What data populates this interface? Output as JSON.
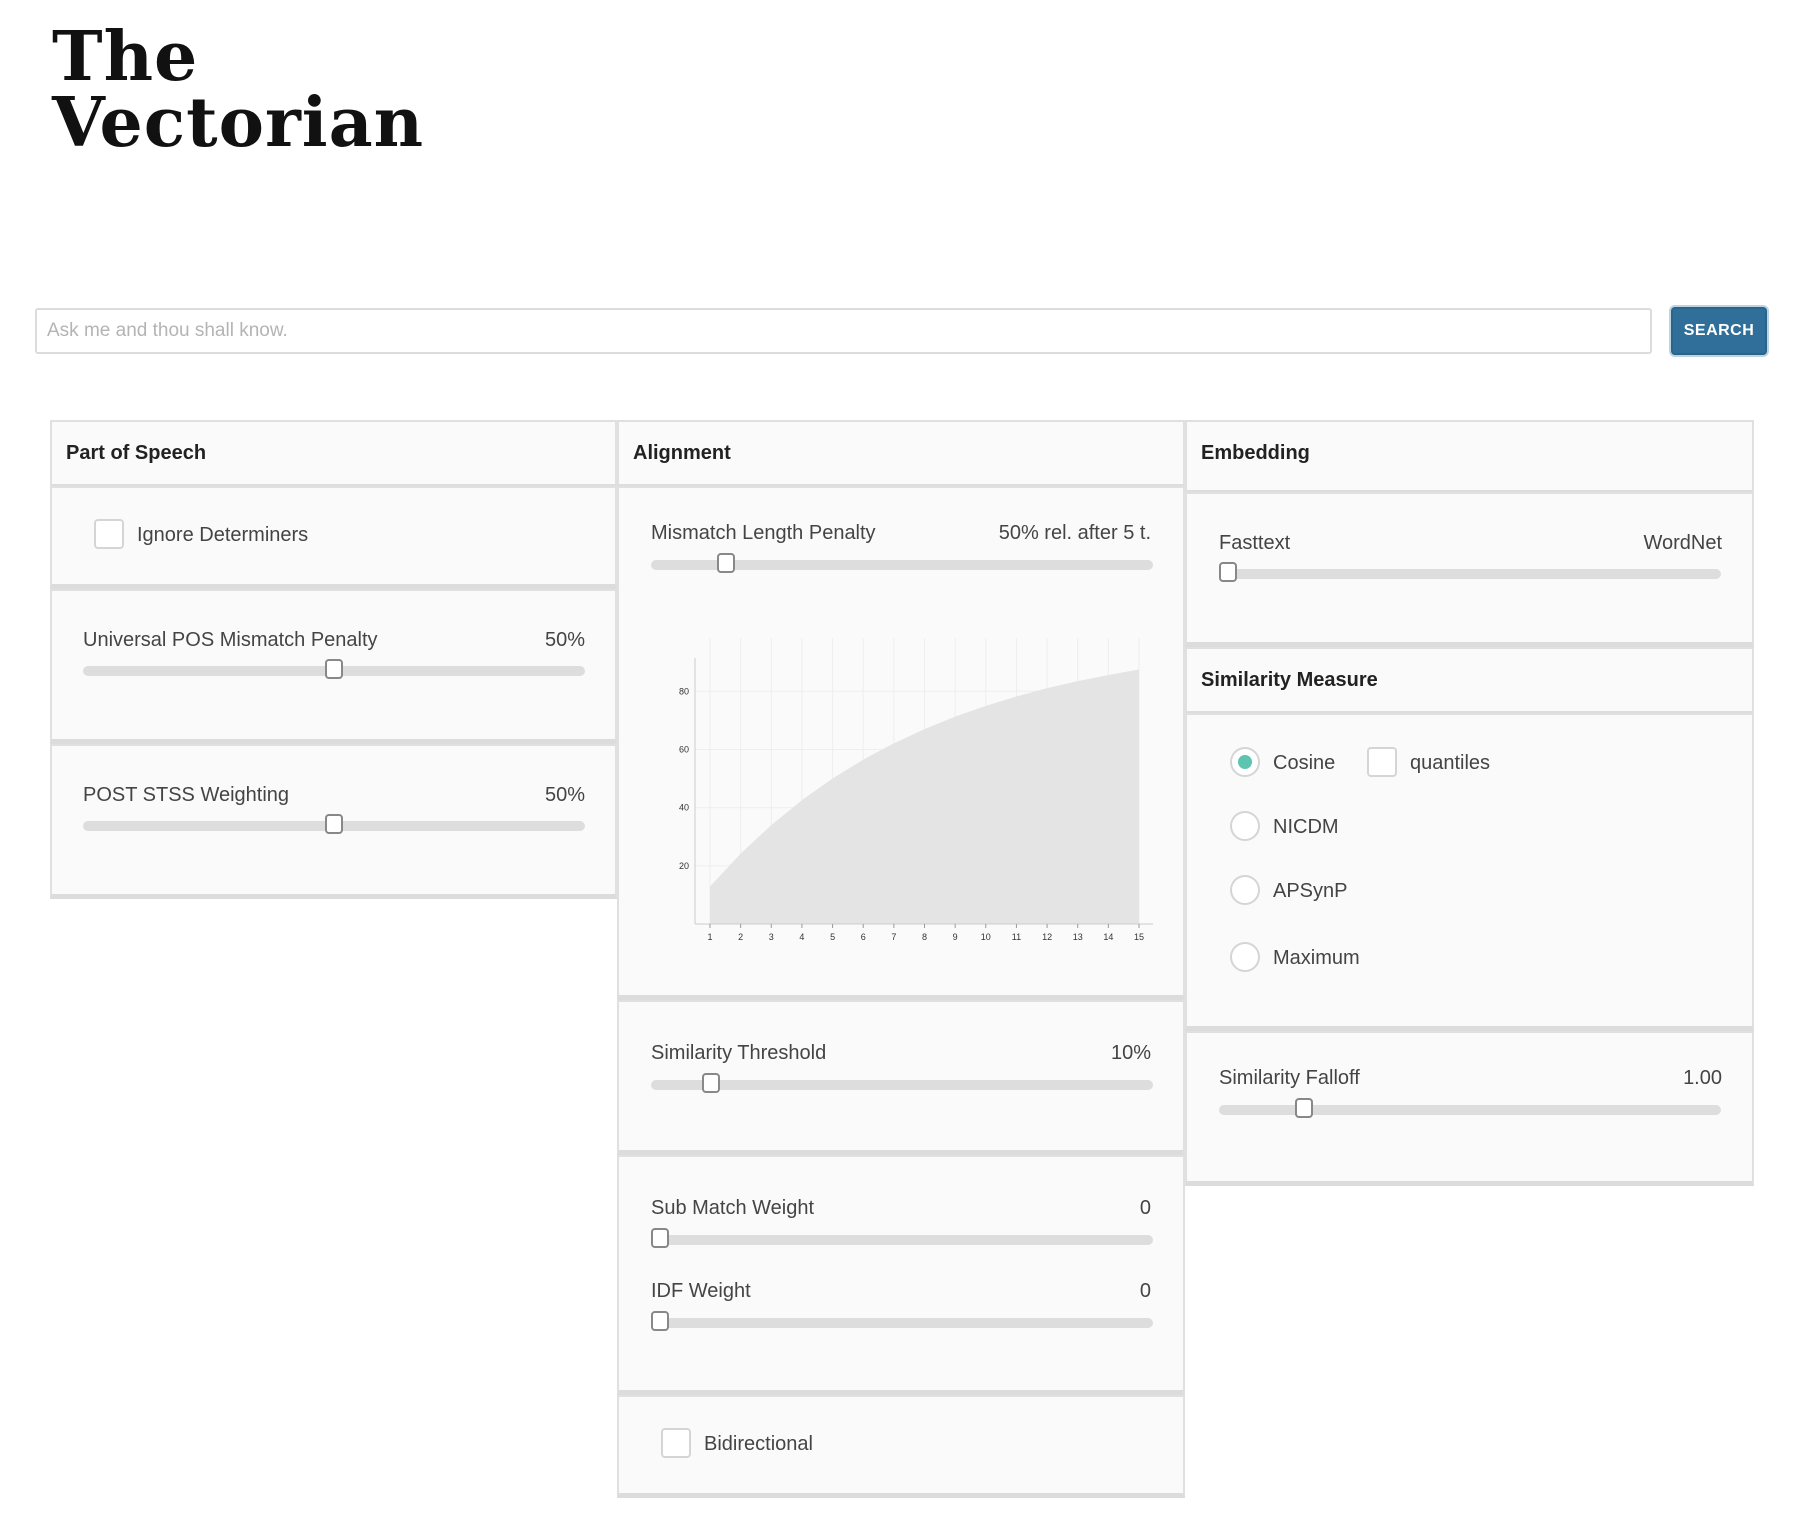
{
  "logo": {
    "line1": "The",
    "line2": "Vectorian"
  },
  "search": {
    "placeholder": "Ask me and thou shall know.",
    "value": "",
    "button_label": "SEARCH"
  },
  "part_of_speech": {
    "title": "Part of Speech",
    "ignore_determiners": {
      "label": "Ignore Determiners",
      "checked": false
    },
    "pos_mismatch": {
      "label": "Universal POS Mismatch Penalty",
      "value_text": "50%",
      "level": 0.5
    },
    "post_stss": {
      "label": "POST STSS Weighting",
      "value_text": "50%",
      "level": 0.5
    }
  },
  "alignment": {
    "title": "Alignment",
    "mismatch_length": {
      "label": "Mismatch Length Penalty",
      "value_text": "50% rel. after 5 t.",
      "level": 0.15
    },
    "similarity_threshold": {
      "label": "Similarity Threshold",
      "value_text": "10%",
      "level": 0.12
    },
    "sub_match_weight": {
      "label": "Sub Match Weight",
      "value_text": "0",
      "level": 0
    },
    "idf_weight": {
      "label": "IDF Weight",
      "value_text": "0",
      "level": 0
    },
    "bidirectional": {
      "label": "Bidirectional",
      "checked": false
    }
  },
  "embedding": {
    "title": "Embedding",
    "left_label": "Fasttext",
    "right_label": "WordNet",
    "level": 0
  },
  "similarity_measure": {
    "title": "Similarity Measure",
    "options": [
      {
        "label": "Cosine",
        "selected": true
      },
      {
        "label": "NICDM",
        "selected": false
      },
      {
        "label": "APSynP",
        "selected": false
      },
      {
        "label": "Maximum",
        "selected": false
      }
    ],
    "quantiles": {
      "label": "quantiles",
      "checked": false
    },
    "falloff": {
      "label": "Similarity Falloff",
      "value_text": "1.00",
      "level": 0.17
    }
  },
  "chart_data": {
    "type": "area",
    "x": [
      1,
      2,
      3,
      4,
      5,
      6,
      7,
      8,
      9,
      10,
      11,
      12,
      13,
      14,
      15
    ],
    "y": [
      12.9,
      24.2,
      34.0,
      42.6,
      50.0,
      56.5,
      62.1,
      67.0,
      71.3,
      75.0,
      78.2,
      81.1,
      83.5,
      85.6,
      87.5
    ],
    "xticks": [
      1,
      2,
      3,
      4,
      5,
      6,
      7,
      8,
      9,
      10,
      11,
      12,
      13,
      14,
      15
    ],
    "yticks": [
      20,
      40,
      60,
      80
    ],
    "ylim": [
      0,
      88
    ],
    "xlim": [
      1,
      15
    ],
    "grid": true,
    "fill_color": "#e4e4e4",
    "title": "",
    "xlabel": "",
    "ylabel": ""
  }
}
